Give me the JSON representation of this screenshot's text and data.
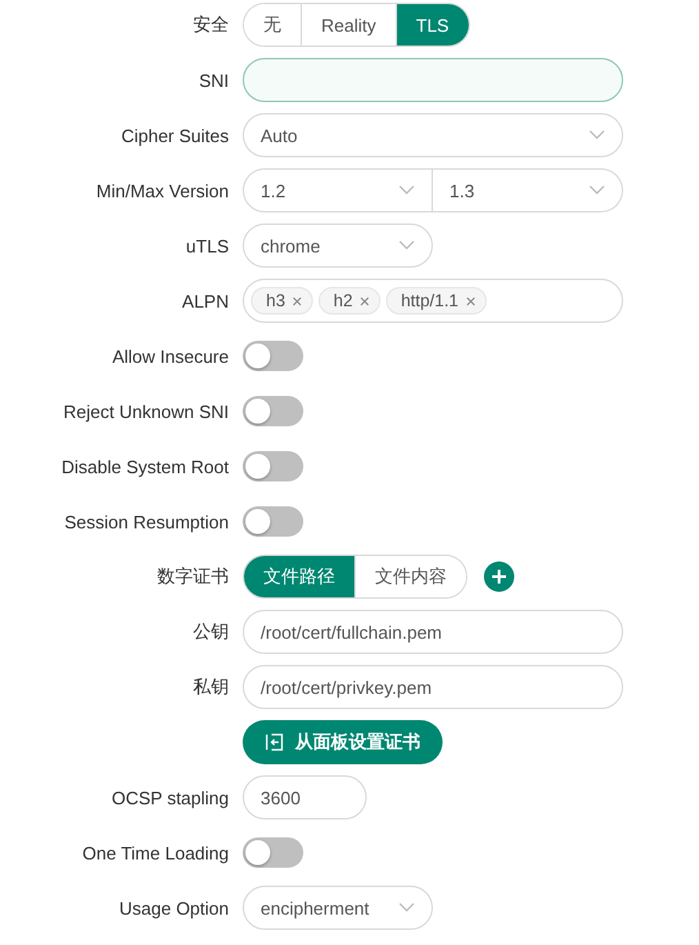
{
  "fields": [
    {
      "kind": "segmented",
      "label": "安全",
      "options": [
        {
          "label": "无",
          "selected": false
        },
        {
          "label": "Reality",
          "selected": false
        },
        {
          "label": "TLS",
          "selected": true
        }
      ]
    },
    {
      "kind": "input",
      "label": "SNI",
      "focused": true
    },
    {
      "kind": "select",
      "label": "Cipher Suites",
      "value": "Auto",
      "wide": true
    },
    {
      "kind": "select-pair",
      "label": "Min/Max Version",
      "values": [
        "1.2",
        "1.3"
      ]
    },
    {
      "kind": "select",
      "label": "uTLS",
      "value": "chrome",
      "wide": false
    },
    {
      "kind": "tags",
      "label": "ALPN",
      "tags": [
        "h3",
        "h2",
        "http/1.1"
      ]
    },
    {
      "kind": "toggle",
      "label": "Allow Insecure",
      "on": false
    },
    {
      "kind": "toggle",
      "label": "Reject Unknown SNI",
      "on": false
    },
    {
      "kind": "toggle",
      "label": "Disable System Root",
      "on": false
    },
    {
      "kind": "toggle",
      "label": "Session Resumption",
      "on": false
    },
    {
      "kind": "segmented",
      "label": "数字证书",
      "options": [
        {
          "label": "文件路径",
          "selected": true
        },
        {
          "label": "文件内容",
          "selected": false
        }
      ],
      "add": true
    },
    {
      "kind": "input",
      "label": "公钥",
      "value": "/root/cert/fullchain.pem",
      "focused": false
    },
    {
      "kind": "input",
      "label": "私钥",
      "value": "/root/cert/privkey.pem",
      "focused": false
    },
    {
      "kind": "button",
      "text": "从面板设置证书"
    },
    {
      "kind": "number",
      "label": "OCSP stapling",
      "value": "3600"
    },
    {
      "kind": "toggle",
      "label": "One Time Loading",
      "on": false
    },
    {
      "kind": "select",
      "label": "Usage Option",
      "value": "encipherment",
      "wide": false
    }
  ]
}
